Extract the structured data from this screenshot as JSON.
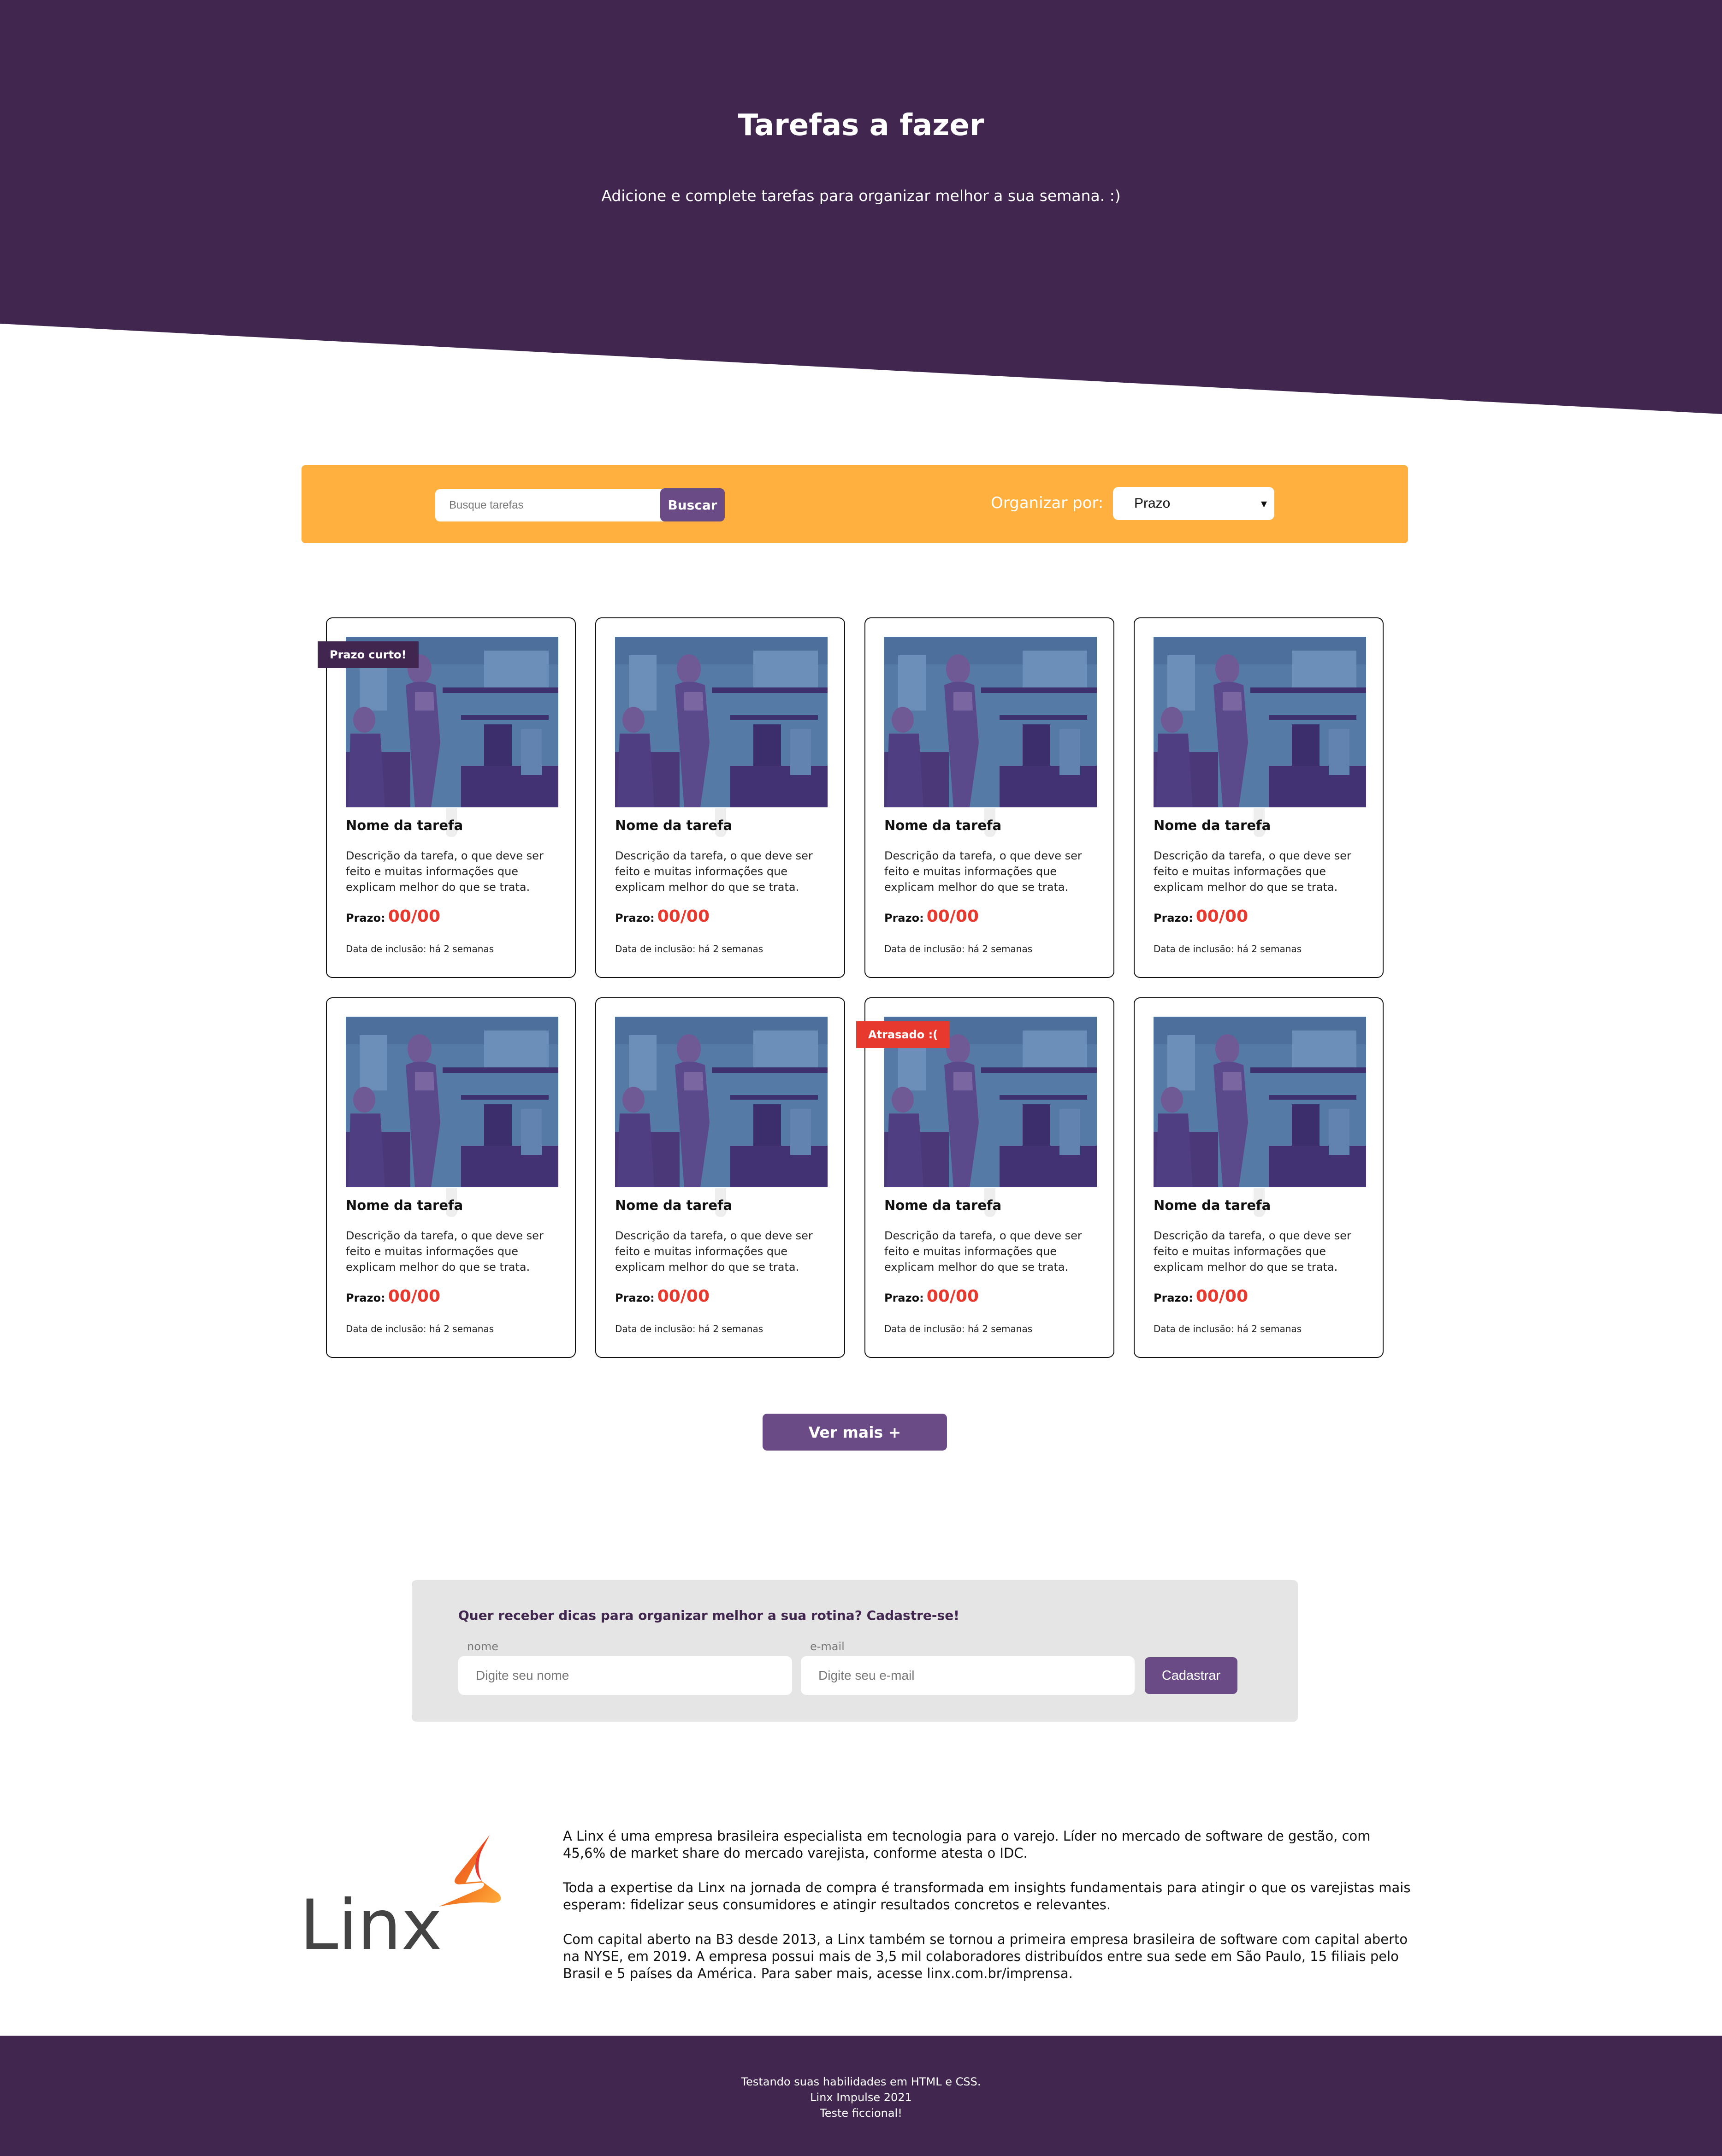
{
  "header": {
    "title": "Tarefas a fazer",
    "subtitle": "Adicione e complete tarefas para organizar melhor a sua semana. :)"
  },
  "colors": {
    "primary_dark": "#41264f",
    "primary": "#6a4b86",
    "accent_orange": "#ffb03f",
    "alert_red": "#e8392e",
    "panel_gray": "#e5e5e5"
  },
  "search": {
    "placeholder": "Busque tarefas",
    "button_label": "Buscar",
    "sort_label": "Organizar por:",
    "sort_selected": "Prazo"
  },
  "tasks": [
    {
      "badge": "Prazo curto!",
      "name": "Nome da tarefa",
      "description": "Descrição da tarefa, o que deve ser feito e muitas informações que explicam melhor do que se trata.",
      "due_label": "Prazo:",
      "due_value": "00/00",
      "date_text": "Data de inclusão: há 2 semanas"
    },
    {
      "badge": "",
      "name": "Nome da tarefa",
      "description": "Descrição da tarefa, o que deve ser feito e muitas informações que explicam melhor do que se trata.",
      "due_label": "Prazo:",
      "due_value": "00/00",
      "date_text": "Data de inclusão: há 2 semanas"
    },
    {
      "badge": "",
      "name": "Nome da tarefa",
      "description": "Descrição da tarefa, o que deve ser feito e muitas informações que explicam melhor do que se trata.",
      "due_label": "Prazo:",
      "due_value": "00/00",
      "date_text": "Data de inclusão: há 2 semanas"
    },
    {
      "badge": "",
      "name": "Nome da tarefa",
      "description": "Descrição da tarefa, o que deve ser feito e muitas informações que explicam melhor do que se trata.",
      "due_label": "Prazo:",
      "due_value": "00/00",
      "date_text": "Data de inclusão: há 2 semanas"
    },
    {
      "badge": "",
      "name": "Nome da tarefa",
      "description": "Descrição da tarefa, o que deve ser feito e muitas informações que explicam melhor do que se trata.",
      "due_label": "Prazo:",
      "due_value": "00/00",
      "date_text": "Data de inclusão: há 2 semanas"
    },
    {
      "badge": "",
      "name": "Nome da tarefa",
      "description": "Descrição da tarefa, o que deve ser feito e muitas informações que explicam melhor do que se trata.",
      "due_label": "Prazo:",
      "due_value": "00/00",
      "date_text": "Data de inclusão: há 2 semanas"
    },
    {
      "badge": "Atrasado :(",
      "name": "Nome da tarefa",
      "description": "Descrição da tarefa, o que deve ser feito e muitas informações que explicam melhor do que se trata.",
      "due_label": "Prazo:",
      "due_value": "00/00",
      "date_text": "Data de inclusão: há 2 semanas"
    },
    {
      "badge": "",
      "name": "Nome da tarefa",
      "description": "Descrição da tarefa, o que deve ser feito e muitas informações que explicam melhor do que se trata.",
      "due_label": "Prazo:",
      "due_value": "00/00",
      "date_text": "Data de inclusão: há 2 semanas"
    }
  ],
  "more_button": "Ver mais +",
  "newsletter": {
    "title": "Quer receber dicas para organizar melhor a sua rotina? Cadastre-se!",
    "name_label": "nome",
    "name_placeholder": "Digite seu nome",
    "email_label": "e-mail",
    "email_placeholder": "Digite seu e-mail",
    "button_label": "Cadastrar"
  },
  "about": {
    "logo_text": "Linx",
    "paragraphs": [
      "A Linx é uma empresa brasileira especialista em tecnologia para o varejo. Líder no mercado de software de gestão, com 45,6% de market share do mercado varejista, conforme atesta o IDC.",
      "Toda a expertise da Linx na jornada de compra é transformada em insights fundamentais para atingir o que os varejistas mais esperam: fidelizar seus consumidores e atingir resultados concretos e relevantes.",
      "Com capital aberto na B3 desde 2013, a Linx também se tornou a primeira empresa brasileira de software com capital aberto na NYSE, em 2019. A empresa possui mais de 3,5 mil colaboradores distribuídos entre sua sede em São Paulo, 15 filiais pelo Brasil e 5 países da América. Para saber mais, acesse linx.com.br/imprensa."
    ]
  },
  "footer": {
    "lines": [
      "Testando suas habilidades em HTML e CSS.",
      "Linx Impulse 2021",
      "Teste ficcional!"
    ]
  }
}
